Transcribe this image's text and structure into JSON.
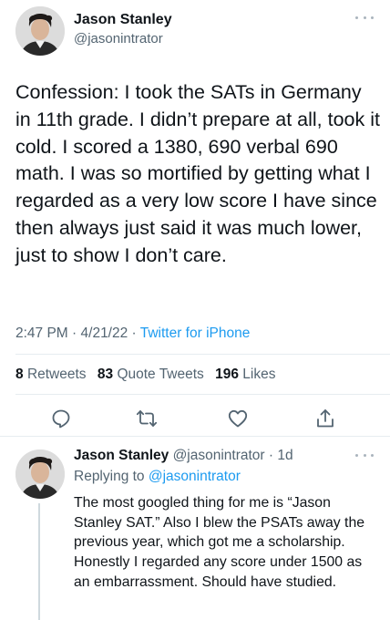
{
  "tweet": {
    "author_name": "Jason Stanley",
    "author_handle": "@jasonintrator",
    "text": "Confession: I took the SATs in Germany in 11th grade. I didn’t prepare at all, took it cold. I scored a 1380, 690 verbal 690 math. I was so mortified by getting what I regarded as a very low score I have since then always just said it was much lower, just to show I don’t care.",
    "time": "2:47 PM",
    "date": "4/21/22",
    "separator": " · ",
    "source": "Twitter for iPhone"
  },
  "stats": {
    "retweets_count": "8",
    "retweets_label": "Retweets",
    "quotes_count": "83",
    "quotes_label": "Quote Tweets",
    "likes_count": "196",
    "likes_label": "Likes"
  },
  "actions": {
    "icons": [
      "reply-icon",
      "retweet-icon",
      "like-icon",
      "share-icon"
    ],
    "color": "#536471"
  },
  "reply": {
    "author_name": "Jason Stanley",
    "author_handle": "@jasonintrator",
    "dot": " · ",
    "age": "1d",
    "replying_label": "Replying to",
    "replying_to": "@jasonintrator",
    "text": "The most googled thing for me is “Jason Stanley SAT.” Also I blew the PSATs away the previous year, which got me a scholarship. Honestly I regarded any score under 1500 as an embarrassment. Should have studied."
  },
  "colors": {
    "text": "#0f1419",
    "secondary": "#536471",
    "link": "#1d9bf0",
    "divider": "#e6ecf0"
  }
}
